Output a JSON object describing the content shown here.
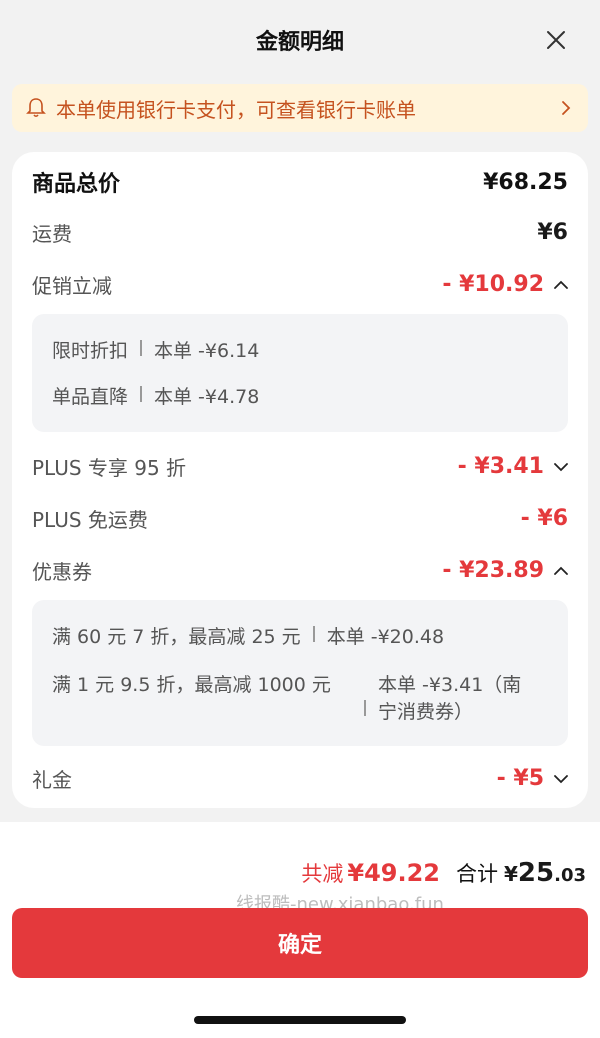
{
  "header": {
    "title": "金额明细"
  },
  "notice": {
    "text": "本单使用银行卡支付，可查看银行卡账单"
  },
  "breakdown": {
    "total": {
      "label": "商品总价",
      "value": "¥68.25"
    },
    "shipping": {
      "label": "运费",
      "value": "¥6"
    },
    "promo": {
      "label": "促销立减",
      "value": "- ¥10.92",
      "items": [
        {
          "name": "限时折扣",
          "amount": "本单 -¥6.14"
        },
        {
          "name": "单品直降",
          "amount": "本单 -¥4.78"
        }
      ]
    },
    "plus_discount": {
      "label": "PLUS 专享 95 折",
      "value": "- ¥3.41"
    },
    "plus_shipping": {
      "label": "PLUS 免运费",
      "value": "- ¥6"
    },
    "coupon": {
      "label": "优惠券",
      "value": "- ¥23.89",
      "items": [
        {
          "name": "满 60 元 7 折，最高减 25 元",
          "amount": "本单 -¥20.48"
        },
        {
          "name": "满 1 元 9.5 折，最高减 1000 元",
          "amount_line1": "本单 -¥3.41（南",
          "amount_line2": "宁消费券）"
        }
      ]
    },
    "gift": {
      "label": "礼金",
      "value": "- ¥5"
    }
  },
  "summary": {
    "saved_label": "共减",
    "saved_value": "¥49.22",
    "total_label": "合计",
    "total_yen": "¥",
    "total_int": "25",
    "total_dec": ".03"
  },
  "watermark": "线报酷-new.xianbao.fun",
  "confirm": {
    "label": "确定"
  },
  "colors": {
    "accent": "#e4393c",
    "notice_bg": "#fff4dc",
    "notice_text": "#c5521f"
  }
}
